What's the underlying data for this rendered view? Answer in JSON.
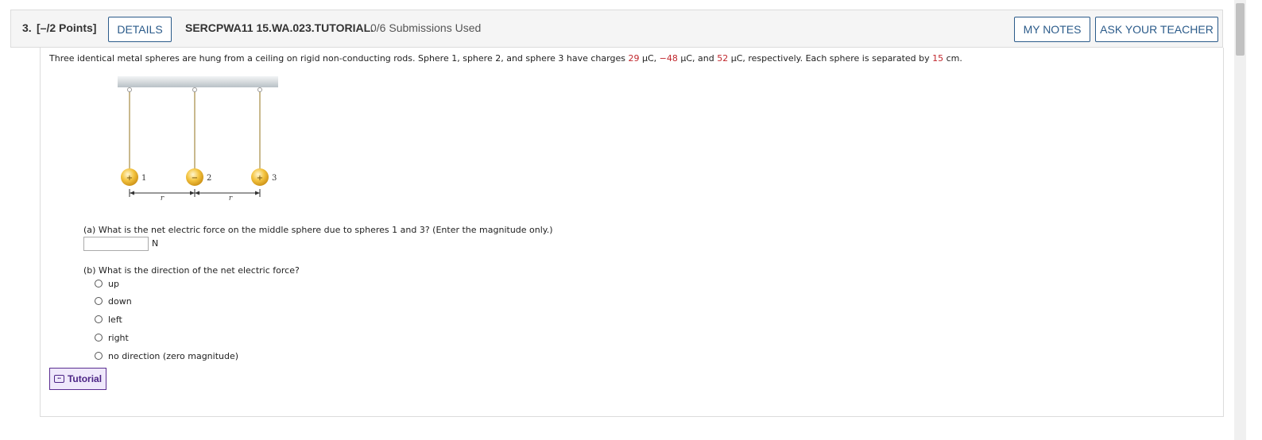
{
  "header": {
    "question_number": "3.",
    "points": "[–/2 Points]",
    "details_label": "DETAILS",
    "assignment_id": "SERCPWA11 15.WA.023.TUTORIAL.",
    "submissions": "0/6 Submissions Used",
    "my_notes_label": "MY NOTES",
    "ask_teacher_label": "ASK YOUR TEACHER"
  },
  "question": {
    "text_1": "Three identical metal spheres are hung from a ceiling on rigid non-conducting rods. Sphere 1, sphere 2, and sphere 3 have charges ",
    "q1": "29",
    "text_2": " μC, ",
    "q2": "−48",
    "text_3": " μC, and ",
    "q3": "52",
    "text_4": " μC, respectively. Each sphere is separated by ",
    "separation": "15",
    "text_5": " cm."
  },
  "figure": {
    "sphere_labels": [
      "1",
      "2",
      "3"
    ],
    "sphere_signs": [
      "+",
      "−",
      "+"
    ],
    "distance_labels": [
      "r",
      "r"
    ]
  },
  "part_a": {
    "prompt": "(a) What is the net electric force on the middle sphere due to spheres 1 and 3? (Enter the magnitude only.)",
    "value": "",
    "unit": "N"
  },
  "part_b": {
    "prompt": "(b) What is the direction of the net electric force?",
    "options": [
      "up",
      "down",
      "left",
      "right",
      "no direction (zero magnitude)"
    ]
  },
  "tutorial": {
    "label": "Tutorial"
  }
}
